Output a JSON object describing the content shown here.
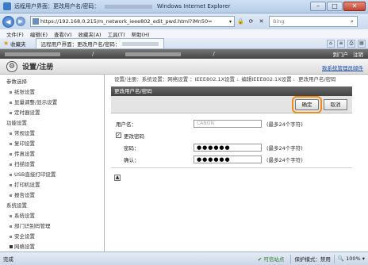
{
  "window": {
    "title": "远程用户界面：更改用户名/密码：",
    "app_name": "Windows Internet Explorer",
    "minimize": "–",
    "maximize": "□",
    "close": "✕"
  },
  "address_bar": {
    "url": "https://192.168.0.215/m_network_ieee802_edit_pwd.html?iMn50=",
    "search_placeholder": "Bing"
  },
  "menu": [
    "文件(F)",
    "编辑(E)",
    "查看(V)",
    "收藏夹(A)",
    "工具(T)",
    "帮助(H)"
  ],
  "favorites": {
    "label": "收藏夹",
    "tab_title": "远程用户界面：更改用户名/密码："
  },
  "header": {
    "page_title": "设置/注册",
    "top_links": [
      "到门户",
      "注销"
    ],
    "mail_link": "致系统管理员邮件"
  },
  "sidebar": {
    "sections": [
      {
        "title": "参数选择",
        "items": [
          "纸张设置",
          "显量调整/显示设置",
          "定时器设置"
        ]
      },
      {
        "title": "功能设置",
        "items": [
          "常规设置",
          "复印设置",
          "传真设置",
          "扫描设置",
          "USB直接打印设置",
          "打印机设置",
          "报告设置"
        ]
      },
      {
        "title": "系统设置",
        "items": [
          "系统设置",
          "部门识别码管理",
          "安全设置",
          "网络设置"
        ]
      }
    ]
  },
  "main": {
    "breadcrumb": [
      "设置/注册：系统设置：网络设置 ：IEEE802.1X设置",
      "编辑IEEE802.1X设置",
      "更改用户名/密码"
    ],
    "panel_title": "更改用户名/密码",
    "ok_button": "确定",
    "cancel_button": "取消",
    "username_label": "用户名：",
    "username_value": "CANON",
    "username_hint": "(最多24个字符)",
    "change_pw_label": "更改密码",
    "password_label": "密码：",
    "password_value": "●●●●●●",
    "password_hint": "(最多24个字符)",
    "confirm_label": "确认：",
    "confirm_value": "●●●●●●",
    "confirm_hint": "(最多24个字符)"
  },
  "status_bar": {
    "left": "完成",
    "site": "可信站点",
    "protected_mode": "保护模式：禁用",
    "zoom": "100%"
  }
}
